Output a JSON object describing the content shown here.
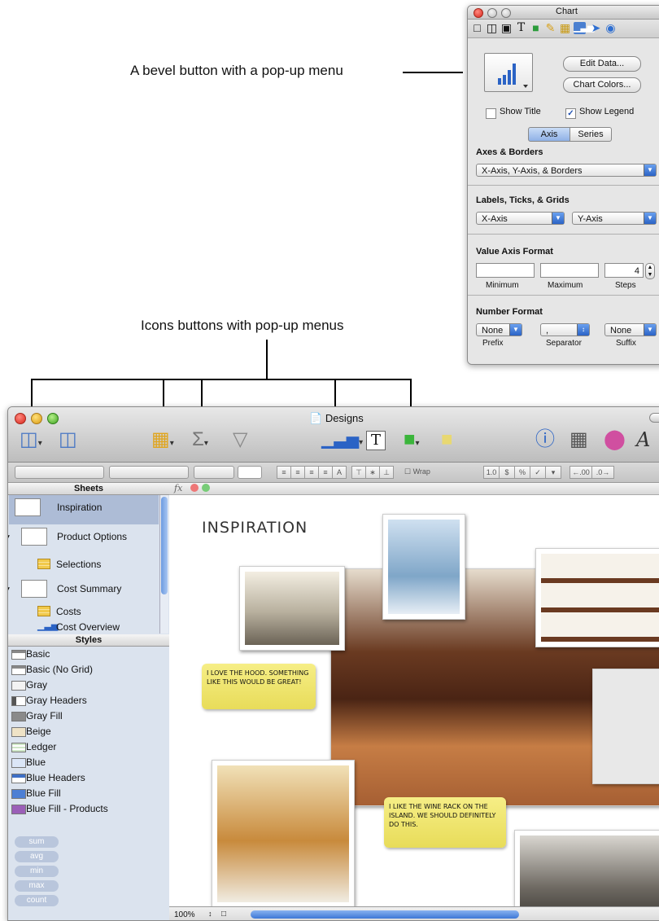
{
  "annotations": {
    "bevel": "A bevel button with a pop-up menu",
    "icons": "Icons buttons with pop-up menus"
  },
  "inspector": {
    "title": "Chart",
    "edit_data": "Edit Data...",
    "chart_colors": "Chart Colors...",
    "show_title": "Show Title",
    "show_legend": "Show Legend",
    "tab_axis": "Axis",
    "tab_series": "Series",
    "axes_borders_head": "Axes & Borders",
    "axes_borders_value": "X-Axis, Y-Axis, & Borders",
    "labels_head": "Labels, Ticks, & Grids",
    "x_axis": "X-Axis",
    "y_axis": "Y-Axis",
    "value_axis_head": "Value Axis Format",
    "steps_value": "4",
    "minimum": "Minimum",
    "maximum": "Maximum",
    "steps": "Steps",
    "number_format_head": "Number Format",
    "prefix_value": "None",
    "separator_value": ",",
    "suffix_value": "None",
    "prefix": "Prefix",
    "separator": "Separator",
    "suffix": "Suffix"
  },
  "window": {
    "title": "Designs",
    "zoom": "100%"
  },
  "sidebar": {
    "sheets_head": "Sheets",
    "sheets": [
      {
        "label": "Inspiration"
      },
      {
        "label": "Product Options"
      },
      {
        "label": "Selections"
      },
      {
        "label": "Cost Summary"
      },
      {
        "label": "Costs"
      },
      {
        "label": "Cost Overview"
      }
    ],
    "styles_head": "Styles",
    "styles": [
      {
        "label": "Basic"
      },
      {
        "label": "Basic (No Grid)"
      },
      {
        "label": "Gray"
      },
      {
        "label": "Gray Headers"
      },
      {
        "label": "Gray Fill"
      },
      {
        "label": "Beige"
      },
      {
        "label": "Ledger"
      },
      {
        "label": "Blue"
      },
      {
        "label": "Blue Headers"
      },
      {
        "label": "Blue Fill"
      },
      {
        "label": "Blue Fill - Products"
      }
    ],
    "functions": [
      "sum",
      "avg",
      "min",
      "max",
      "count"
    ]
  },
  "canvas": {
    "heading": "INSPIRATION",
    "note1": "I LOVE THE HOOD. SOMETHING LIKE THIS WOULD BE GREAT!",
    "note2": "I LIKE THE WINE RACK ON THE ISLAND. WE SHOULD DEFINITELY DO THIS."
  }
}
